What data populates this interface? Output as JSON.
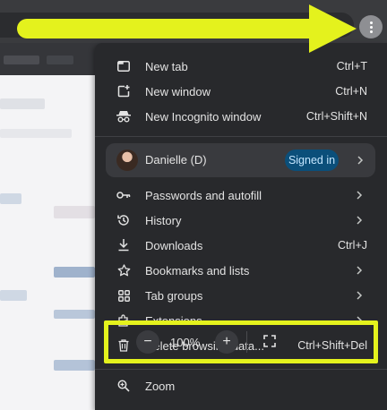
{
  "menu": {
    "new_tab": {
      "label": "New tab",
      "shortcut": "Ctrl+T"
    },
    "new_window": {
      "label": "New window",
      "shortcut": "Ctrl+N"
    },
    "new_incognito": {
      "label": "New Incognito window",
      "shortcut": "Ctrl+Shift+N"
    },
    "profile": {
      "name": "Danielle (D)",
      "status": "Signed in"
    },
    "passwords": {
      "label": "Passwords and autofill"
    },
    "history": {
      "label": "History"
    },
    "downloads": {
      "label": "Downloads",
      "shortcut": "Ctrl+J"
    },
    "bookmarks": {
      "label": "Bookmarks and lists"
    },
    "tab_groups": {
      "label": "Tab groups"
    },
    "extensions": {
      "label": "Extensions"
    },
    "delete_data": {
      "label": "Delete browsing data...",
      "shortcut": "Ctrl+Shift+Del"
    },
    "zoom": {
      "label": "Zoom",
      "value": "100%",
      "minus": "−",
      "plus": "+"
    }
  },
  "colors": {
    "menu_bg": "#28292c",
    "accent_annotation": "#e4f21d",
    "signed_in_bg": "#0b4f7a",
    "signed_in_text": "#c4e6ff"
  },
  "icons": [
    "more-vert-icon",
    "new-tab-icon",
    "new-window-icon",
    "incognito-icon",
    "key-icon",
    "history-icon",
    "download-icon",
    "star-icon",
    "tab-groups-icon",
    "extensions-icon",
    "trash-icon",
    "zoom-icon",
    "fullscreen-icon",
    "chevron-right-icon"
  ]
}
